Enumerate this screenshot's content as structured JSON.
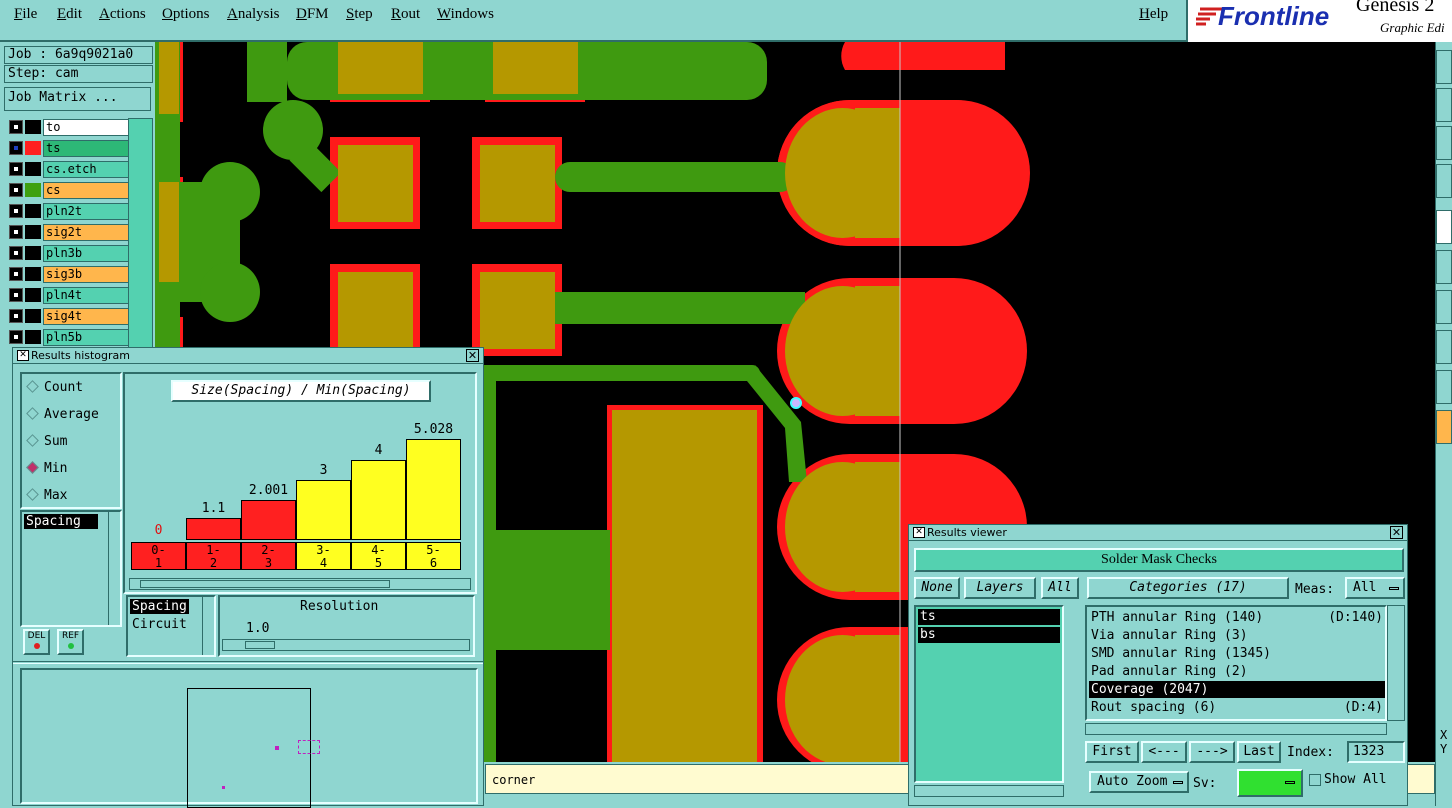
{
  "menu": [
    "File",
    "Edit",
    "Actions",
    "Options",
    "Analysis",
    "DFM",
    "Step",
    "Rout",
    "Windows"
  ],
  "help": "Help",
  "brand": {
    "name": "Frontline",
    "product": "Genesis 2",
    "subtitle": "Graphic Edi"
  },
  "job": {
    "job_label": "Job : 6a9q9021a0",
    "step_label": "Step: cam",
    "matrix_button": "Job Matrix ..."
  },
  "layers": [
    {
      "name": "to",
      "color": "#000000",
      "selected": false
    },
    {
      "name": "ts",
      "color": "#ff2020",
      "selected": true
    },
    {
      "name": "cs.etch",
      "color": "#000000",
      "selected": false
    },
    {
      "name": "cs",
      "color": "#3fa010",
      "selected": true
    },
    {
      "name": "pln2t",
      "color": "#000000",
      "selected": false
    },
    {
      "name": "sig2t",
      "color": "#000000",
      "selected": true
    },
    {
      "name": "pln3b",
      "color": "#000000",
      "selected": false
    },
    {
      "name": "sig3b",
      "color": "#000000",
      "selected": true
    },
    {
      "name": "pln4t",
      "color": "#000000",
      "selected": false
    },
    {
      "name": "sig4t",
      "color": "#000000",
      "selected": true
    },
    {
      "name": "pln5b",
      "color": "#000000",
      "selected": false
    }
  ],
  "histogram": {
    "title": "Results histogram",
    "heading": "Size(Spacing) / Min(Spacing)",
    "modes": [
      "Count",
      "Average",
      "Sum",
      "Min",
      "Max"
    ],
    "selected_mode": "Min",
    "list_item": "Spacing",
    "sub_list": [
      "Spacing",
      "Circuit"
    ],
    "resolution_label": "Resolution",
    "resolution_value": "1.0",
    "del_label": "DEL",
    "ref_label": "REF"
  },
  "chart_data": {
    "type": "bar",
    "title": "Size(Spacing) / Min(Spacing)",
    "categories": [
      "0-\n1",
      "1-\n2",
      "2-\n3",
      "3-\n4",
      "4-\n5",
      "5-\n6"
    ],
    "values": [
      0,
      1.1,
      2.001,
      3,
      4,
      5.028
    ],
    "value_labels": [
      "0",
      "1.1",
      "2.001",
      "3",
      "4",
      "5.028"
    ],
    "colors": [
      "#ff2020",
      "#ff2020",
      "#ff2020",
      "#ffff20",
      "#ffff20",
      "#ffff20"
    ],
    "ylim": [
      0,
      5.6
    ]
  },
  "status": {
    "text": "corner"
  },
  "viewer": {
    "title": "Results viewer",
    "header": "Solder Mask Checks",
    "none_btn": "None",
    "layers_btn": "Layers",
    "all_btn": "All",
    "layer_items": [
      "ts",
      "bs"
    ],
    "categories_btn": "Categories (17)",
    "meas_label": "Meas:",
    "meas_value": "All",
    "items": [
      {
        "label": "PTH annular Ring (140)",
        "meas": "(D:140)"
      },
      {
        "label": "Via annular Ring (3)",
        "meas": ""
      },
      {
        "label": "SMD annular Ring (1345)",
        "meas": ""
      },
      {
        "label": "Pad annular Ring (2)",
        "meas": ""
      },
      {
        "label": "Coverage (2047)",
        "meas": ""
      },
      {
        "label": "Rout spacing (6)",
        "meas": "(D:4)"
      }
    ],
    "selected_index": 4,
    "first_btn": "First",
    "prev_btn": "<---",
    "next_btn": "--->",
    "last_btn": "Last",
    "index_label": "Index:",
    "index_value": "1323",
    "autozoom_btn": "Auto Zoom",
    "sv_label": "Sv:",
    "showall_label": "Show All"
  },
  "coords": {
    "x": "X",
    "y": "Y"
  }
}
